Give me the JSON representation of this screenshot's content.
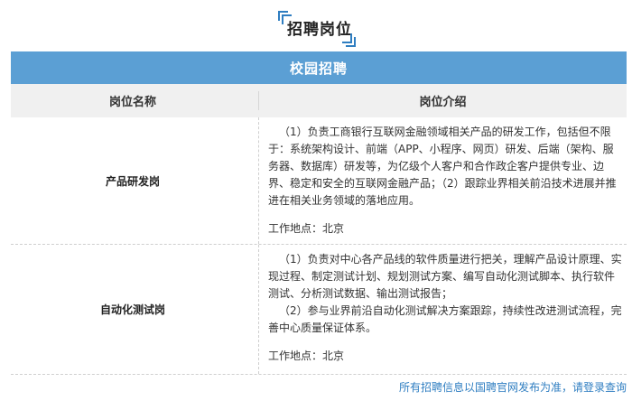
{
  "page": {
    "title": "招聘岗位",
    "section": "校园招聘"
  },
  "table": {
    "headers": [
      "岗位名称",
      "岗位介绍"
    ],
    "rows": [
      {
        "name": "产品研发岗",
        "desc": "（1）负责工商银行互联网金融领域相关产品的研发工作，包括但不限于：系统架构设计、前端（APP、小程序、网页）研发、后端（架构、服务器、数据库）研发等，为亿级个人客户和合作政企客户提供专业、边界、稳定和安全的互联网金融产品；（2）跟踪业界相关前沿技术进展并推进在相关业务领域的落地应用。",
        "location": "工作地点：北京"
      },
      {
        "name": "自动化测试岗",
        "desc1": "（1）负责对中心各产品线的软件质量进行把关，理解产品设计原理、实现过程、制定测试计划、规划测试方案、编写自动化测试脚本、执行软件测试、分析测试数据、输出测试报告；",
        "desc2": "（2）参与业界前沿自动化测试解决方案跟踪，持续性改进测试流程，完善中心质量保证体系。",
        "location": "工作地点：北京"
      }
    ]
  },
  "footer": {
    "note": "所有招聘信息以国聘官网发布为准，请登录查询"
  },
  "colors": {
    "accent": "#2f7ec1",
    "banner": "#5b9fd4",
    "header_bg": "#f0f0f0"
  }
}
